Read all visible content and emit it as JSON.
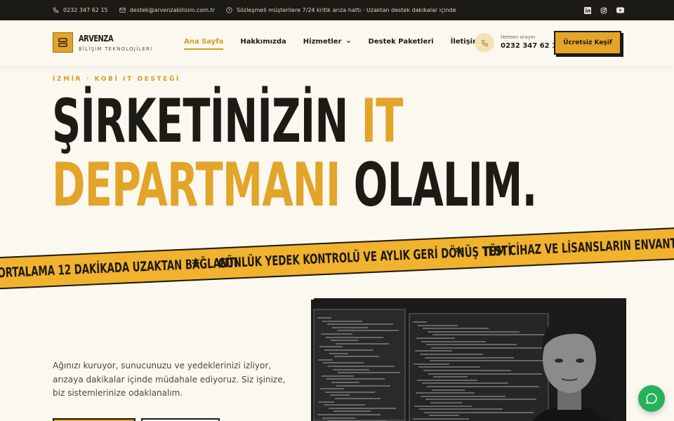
{
  "topbar": {
    "phone": "0232 347 62 15",
    "email": "destek@arvenzabilisim.com.tr",
    "notice": "Sözleşmeli müşterilere 7/24 kritik arıza hattı · Uzaktan destek dakikalar içinde",
    "social": [
      "linkedin-icon",
      "instagram-icon",
      "youtube-icon"
    ]
  },
  "header": {
    "logo_name": "ARVENZA",
    "logo_sub": "BİLİŞİM TEKNOLOJİLERİ",
    "nav": [
      {
        "label": "Ana Sayfa",
        "active": true
      },
      {
        "label": "Hakkımızda"
      },
      {
        "label": "Hizmetler",
        "dropdown": true
      },
      {
        "label": "Destek Paketleri"
      },
      {
        "label": "İletişim"
      }
    ],
    "call_label": "Hemen arayın",
    "call_number": "0232 347 62 15",
    "cta": "Ücretsiz Keşif"
  },
  "hero": {
    "eyebrow": "İZMİR · KOBİ IT DESTEĞİ",
    "title_l1a": "ŞİRKETİNİZİN ",
    "title_l1b": "IT",
    "title_l2a": "DEPARTMANI",
    "title_l2b": " OLALIM."
  },
  "ribbon": {
    "items": [
      "ORTALAMA 12 DAKİKADA UZAKTAN BAĞLANTI",
      "GÜNLÜK YEDEK KONTROLÜ VE AYLIK GERİ DÖNÜŞ TESTİ",
      "TÜM CİHAZ VE LİSANSLARIN ENVANTERİ"
    ],
    "separator": "*"
  },
  "intro": {
    "lead": "Ağınızı kuruyor, sunucunuzu ve yedeklerinizi izliyor, arızaya dakikalar içinde müdahale ediyoruz. Siz işinize, biz sistemlerinize odaklanalım."
  },
  "colors": {
    "accent": "#e2a429",
    "dark": "#1c1a15",
    "background": "#fbf8f0",
    "chat": "#25b35a"
  }
}
